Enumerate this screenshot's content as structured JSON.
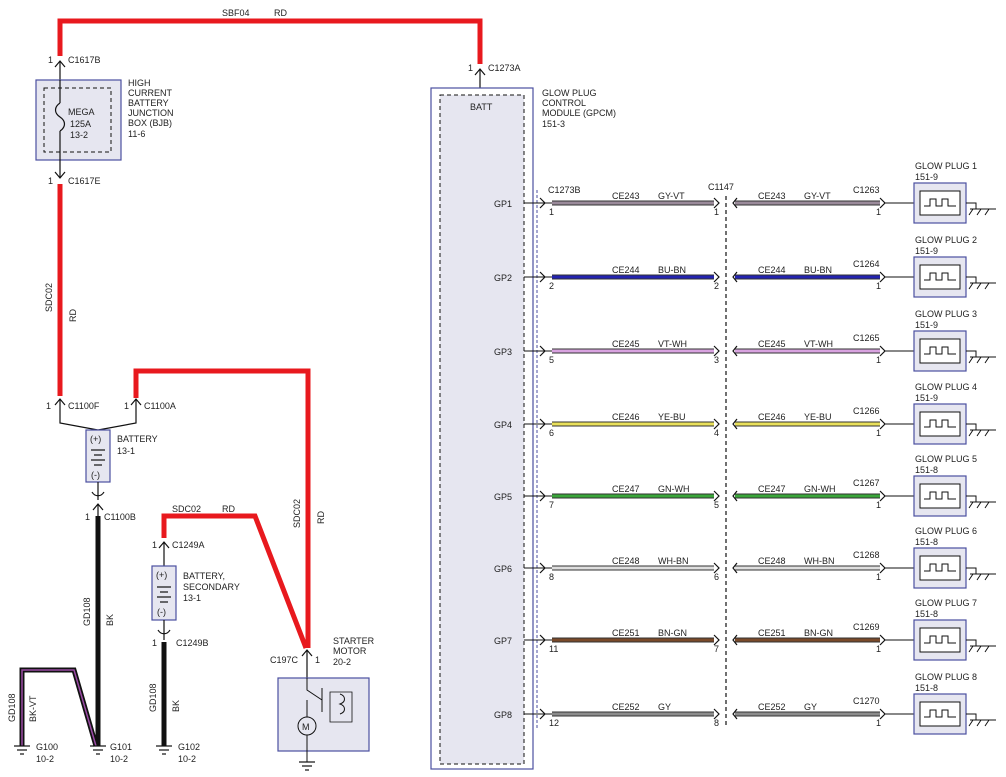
{
  "colors": {
    "red": "#e8191e",
    "black": "#111111",
    "component_border": "#4b4fa0",
    "component_fill": "#e6e6f0",
    "gy_vt": "#9a8a9a",
    "bu_bn": "#2323b0",
    "vt_wh": "#d9a3e0",
    "ye_bu": "#e9e05a",
    "gn_wh": "#3aa63a",
    "wh_bn": "#dedede",
    "bn_gn": "#7a4a2a",
    "gy": "#8c8c8c",
    "bk_vt_outer": "#111111",
    "bk_vt_inner": "#9a4aa4"
  },
  "wires": {
    "sbf04": {
      "circuit": "SBF04",
      "color": "RD"
    },
    "sdc02_main": {
      "circuit": "SDC02",
      "color": "RD"
    },
    "sdc02_starter": {
      "circuit": "SDC02",
      "color": "RD"
    },
    "sdc02_secondary": {
      "circuit": "SDC02",
      "color": "RD"
    },
    "gd108_main": {
      "circuit": "GD108",
      "color": "BK"
    },
    "gd108_secondary": {
      "circuit": "GD108",
      "color": "BK"
    },
    "gd108_g100": {
      "circuit": "GD108",
      "color": "BK-VT"
    }
  },
  "connectors": {
    "c1617b": {
      "pin": "1",
      "name": "C1617B"
    },
    "c1617e": {
      "pin": "1",
      "name": "C1617E"
    },
    "c1273a": {
      "pin": "1",
      "name": "C1273A"
    },
    "c1100f": {
      "pin": "1",
      "name": "C1100F"
    },
    "c1100a": {
      "pin": "1",
      "name": "C1100A"
    },
    "c1100b": {
      "pin": "1",
      "name": "C1100B"
    },
    "c1249a": {
      "pin": "1",
      "name": "C1249A"
    },
    "c1249b": {
      "pin": "1",
      "name": "C1249B"
    },
    "c197c": {
      "pin": "1",
      "name": "C197C"
    },
    "c1273b": {
      "name": "C1273B"
    },
    "c1147": {
      "name": "C1147"
    }
  },
  "components": {
    "bjb": {
      "line1": "HIGH",
      "line2": "CURRENT",
      "line3": "BATTERY",
      "line4": "JUNCTION",
      "line5": "BOX (BJB)",
      "ref": "11-6"
    },
    "mega_fuse": {
      "line1": "MEGA",
      "line2": "125A",
      "line3": "13-2"
    },
    "battery": {
      "name": "BATTERY",
      "ref": "13-1",
      "plus": "(+)",
      "minus": "(-)"
    },
    "battery_secondary": {
      "line1": "BATTERY,",
      "line2": "SECONDARY",
      "ref": "13-1",
      "plus": "(+)",
      "minus": "(-)"
    },
    "starter": {
      "line1": "STARTER",
      "line2": "MOTOR",
      "ref": "20-2"
    },
    "gpcm": {
      "line1": "GLOW PLUG",
      "line2": "CONTROL",
      "line3": "MODULE (GPCM)",
      "ref": "151-3",
      "batt": "BATT"
    }
  },
  "grounds": [
    {
      "name": "G100",
      "ref": "10-2"
    },
    {
      "name": "G101",
      "ref": "10-2"
    },
    {
      "name": "G102",
      "ref": "10-2"
    }
  ],
  "glow_circuits": [
    {
      "gp": "GP1",
      "circuit": "CE243",
      "color": "GY-VT",
      "color_key": "gy_vt",
      "gpcm_pin": "1",
      "inline_pin": "1",
      "plug_conn": "C1263",
      "plug_pin": "1",
      "plug_name": "GLOW PLUG 1",
      "plug_ref": "151-9"
    },
    {
      "gp": "GP2",
      "circuit": "CE244",
      "color": "BU-BN",
      "color_key": "bu_bn",
      "gpcm_pin": "2",
      "inline_pin": "2",
      "plug_conn": "C1264",
      "plug_pin": "1",
      "plug_name": "GLOW PLUG 2",
      "plug_ref": "151-9"
    },
    {
      "gp": "GP3",
      "circuit": "CE245",
      "color": "VT-WH",
      "color_key": "vt_wh",
      "gpcm_pin": "5",
      "inline_pin": "3",
      "plug_conn": "C1265",
      "plug_pin": "1",
      "plug_name": "GLOW PLUG 3",
      "plug_ref": "151-9"
    },
    {
      "gp": "GP4",
      "circuit": "CE246",
      "color": "YE-BU",
      "color_key": "ye_bu",
      "gpcm_pin": "6",
      "inline_pin": "4",
      "plug_conn": "C1266",
      "plug_pin": "1",
      "plug_name": "GLOW PLUG 4",
      "plug_ref": "151-9"
    },
    {
      "gp": "GP5",
      "circuit": "CE247",
      "color": "GN-WH",
      "color_key": "gn_wh",
      "gpcm_pin": "7",
      "inline_pin": "5",
      "plug_conn": "C1267",
      "plug_pin": "1",
      "plug_name": "GLOW PLUG 5",
      "plug_ref": "151-8"
    },
    {
      "gp": "GP6",
      "circuit": "CE248",
      "color": "WH-BN",
      "color_key": "wh_bn",
      "gpcm_pin": "8",
      "inline_pin": "6",
      "plug_conn": "C1268",
      "plug_pin": "1",
      "plug_name": "GLOW PLUG 6",
      "plug_ref": "151-8"
    },
    {
      "gp": "GP7",
      "circuit": "CE251",
      "color": "BN-GN",
      "color_key": "bn_gn",
      "gpcm_pin": "11",
      "inline_pin": "7",
      "plug_conn": "C1269",
      "plug_pin": "1",
      "plug_name": "GLOW PLUG 7",
      "plug_ref": "151-8"
    },
    {
      "gp": "GP8",
      "circuit": "CE252",
      "color": "GY",
      "color_key": "gy",
      "gpcm_pin": "12",
      "inline_pin": "8",
      "plug_conn": "C1270",
      "plug_pin": "1",
      "plug_name": "GLOW PLUG 8",
      "plug_ref": "151-8"
    }
  ]
}
